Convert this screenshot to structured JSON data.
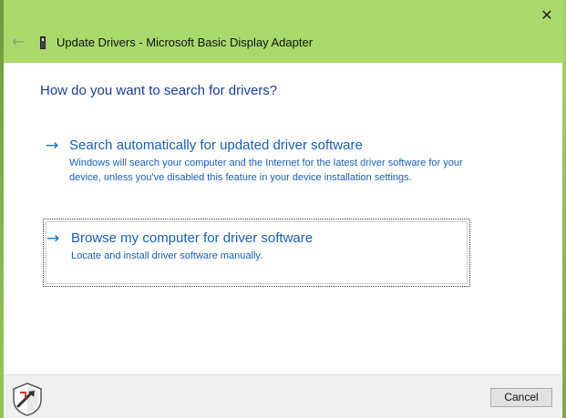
{
  "window": {
    "title": "Update Drivers - Microsoft Basic Display Adapter",
    "close_glyph": "✕",
    "back_glyph": "←"
  },
  "main": {
    "heading": "How do you want to search for drivers?",
    "options": [
      {
        "arrow": "→",
        "title": "Search automatically for updated driver software",
        "description": "Windows will search your computer and the Internet for the latest driver software for your device, unless you've disabled this feature in your device installation settings."
      },
      {
        "arrow": "→",
        "title": "Browse my computer for driver software",
        "description": "Locate and install driver software manually."
      }
    ]
  },
  "footer": {
    "cancel_label": "Cancel"
  },
  "colors": {
    "titlebar": "#a9d96b",
    "link_blue": "#1a5fb4",
    "heading_blue": "#1a3f8f"
  }
}
